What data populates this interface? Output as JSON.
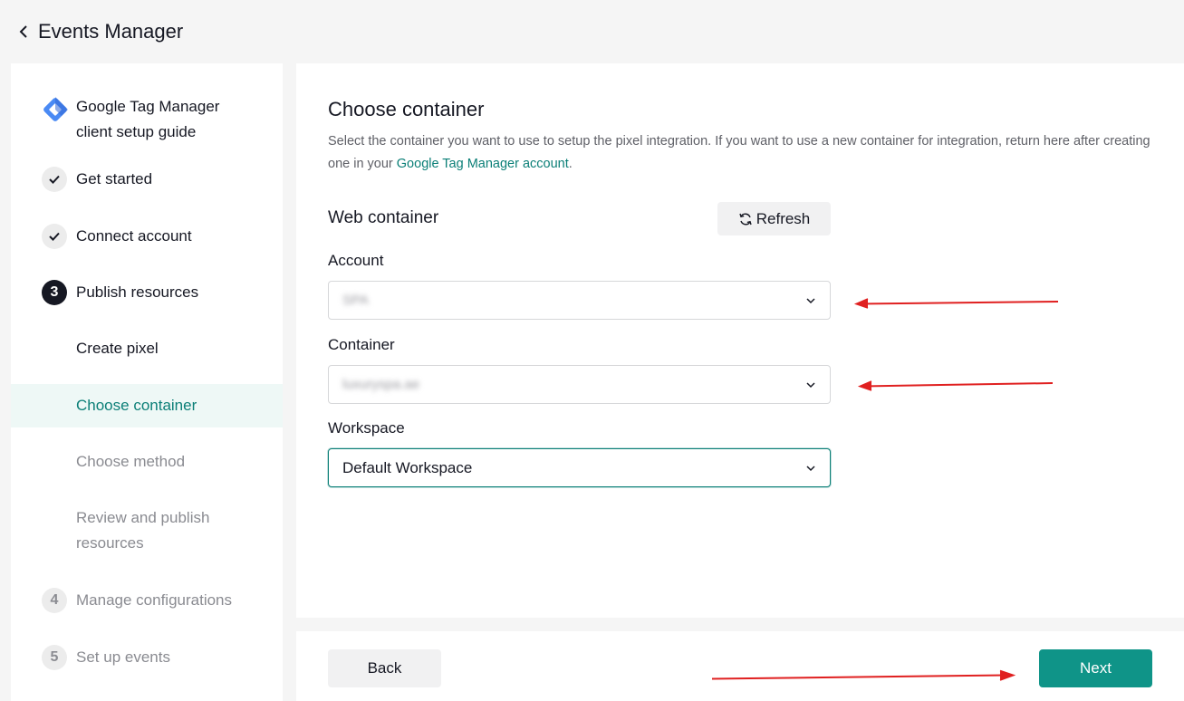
{
  "header": {
    "title": "Events Manager"
  },
  "sidebar": {
    "guide_title": "Google Tag Manager client setup guide",
    "steps": [
      {
        "label": "Get started",
        "status": "done"
      },
      {
        "label": "Connect account",
        "status": "done"
      },
      {
        "number": "3",
        "label": "Publish resources",
        "status": "current"
      },
      {
        "number": "4",
        "label": "Manage configurations",
        "status": "pending"
      },
      {
        "number": "5",
        "label": "Set up events",
        "status": "pending"
      }
    ],
    "substeps": [
      {
        "label": "Create pixel"
      },
      {
        "label": "Choose container",
        "active": true
      },
      {
        "label": "Choose method"
      },
      {
        "label": "Review and publish resources"
      }
    ]
  },
  "main": {
    "title": "Choose container",
    "description_before": "Select the container you want to use to setup the pixel integration. If you want to use a new container for integration, return here after creating one in your ",
    "description_link": "Google Tag Manager account",
    "description_after": ".",
    "section_title": "Web container",
    "refresh_label": "Refresh",
    "fields": {
      "account": {
        "label": "Account",
        "value": "SPA"
      },
      "container": {
        "label": "Container",
        "value": "luxuryspa.ae"
      },
      "workspace": {
        "label": "Workspace",
        "value": "Default Workspace"
      }
    }
  },
  "footer": {
    "back_label": "Back",
    "next_label": "Next"
  },
  "colors": {
    "accent": "#0f9488",
    "annotation_arrow": "#e02020"
  }
}
